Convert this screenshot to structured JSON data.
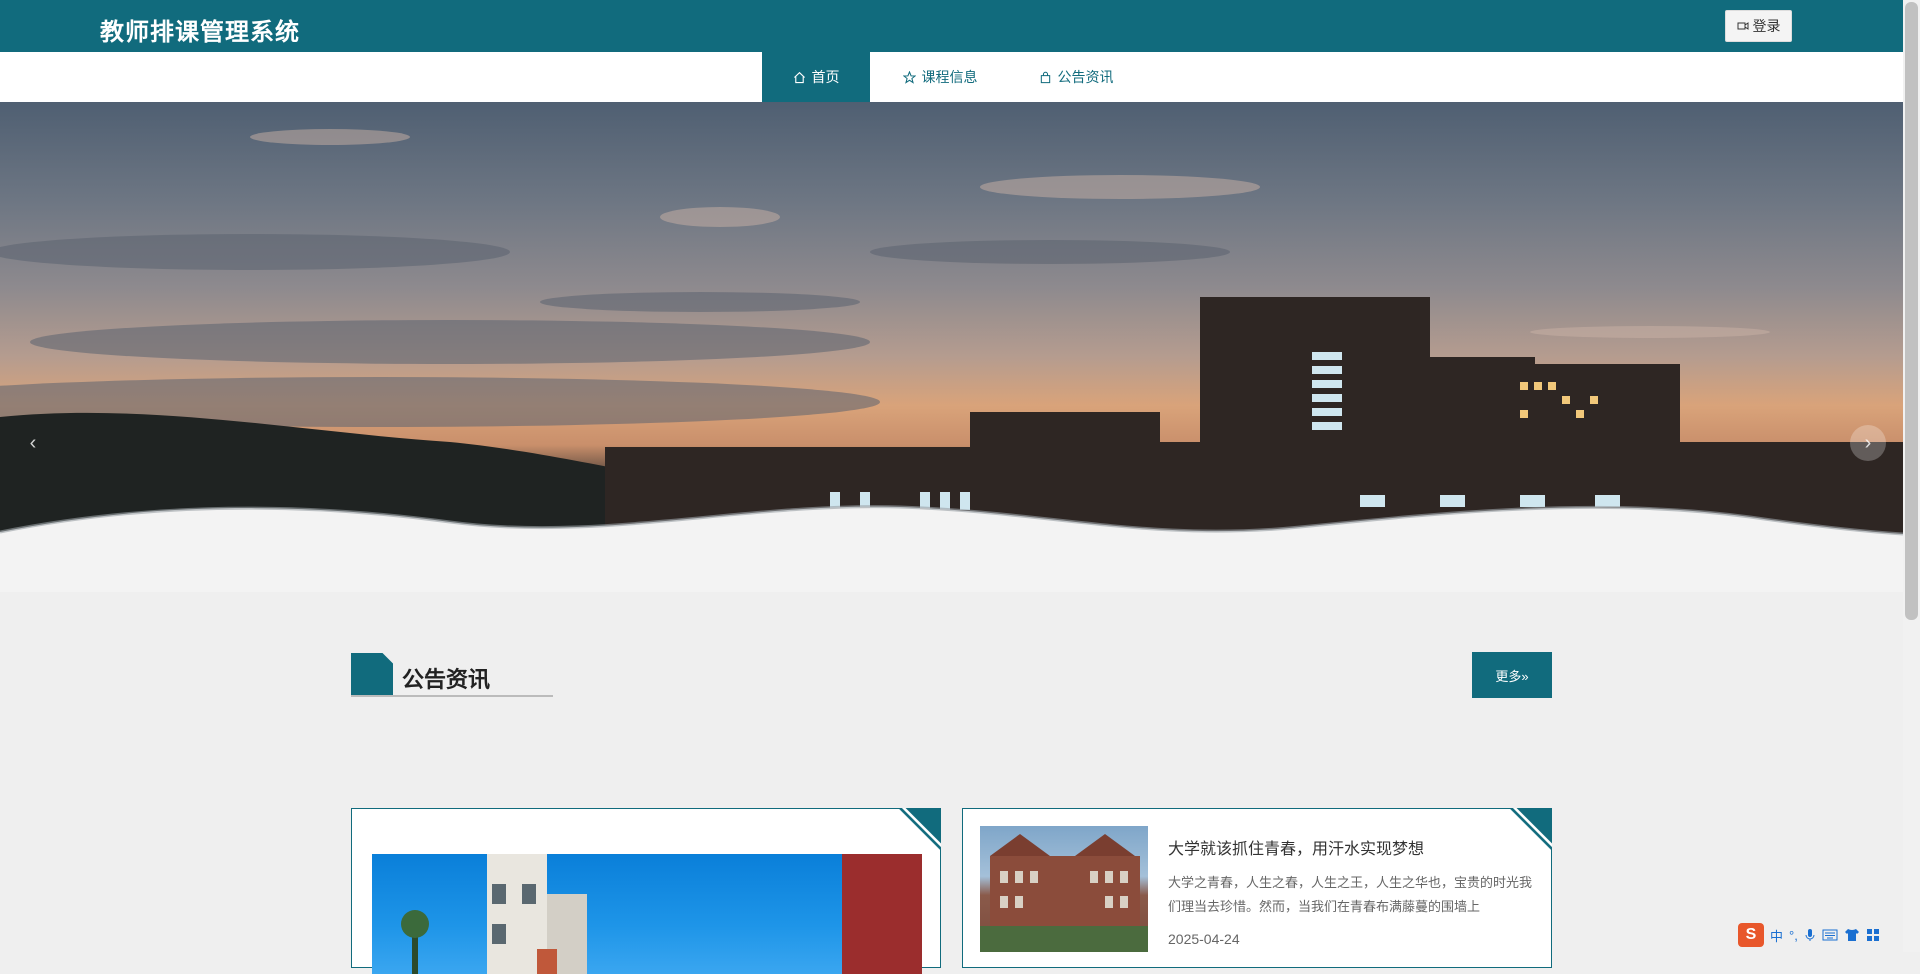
{
  "header": {
    "site_title": "教师排课管理系统",
    "login_label": "登录"
  },
  "nav": {
    "items": [
      {
        "label": "首页",
        "icon": "home-icon",
        "active": true
      },
      {
        "label": "课程信息",
        "icon": "star-icon",
        "active": false
      },
      {
        "label": "公告资讯",
        "icon": "bag-icon",
        "active": false
      }
    ]
  },
  "carousel": {
    "prev_label": "‹",
    "next_label": "›"
  },
  "news_section": {
    "title": "公告资讯",
    "more_label": "更多»",
    "cards": [
      {
        "title": "大学就该抓住青春，用汗水实现梦想",
        "description": "大学之青春，人生之春，人生之王，人生之华也，宝贵的时光我们理当去珍惜。然而，当我们在青春布满藤蔓的围墙上",
        "date": "2025-04-24"
      }
    ]
  },
  "ime_tray": {
    "logo": "S",
    "mode": "中"
  },
  "colors": {
    "primary": "#116b7d",
    "background": "#efefef"
  }
}
